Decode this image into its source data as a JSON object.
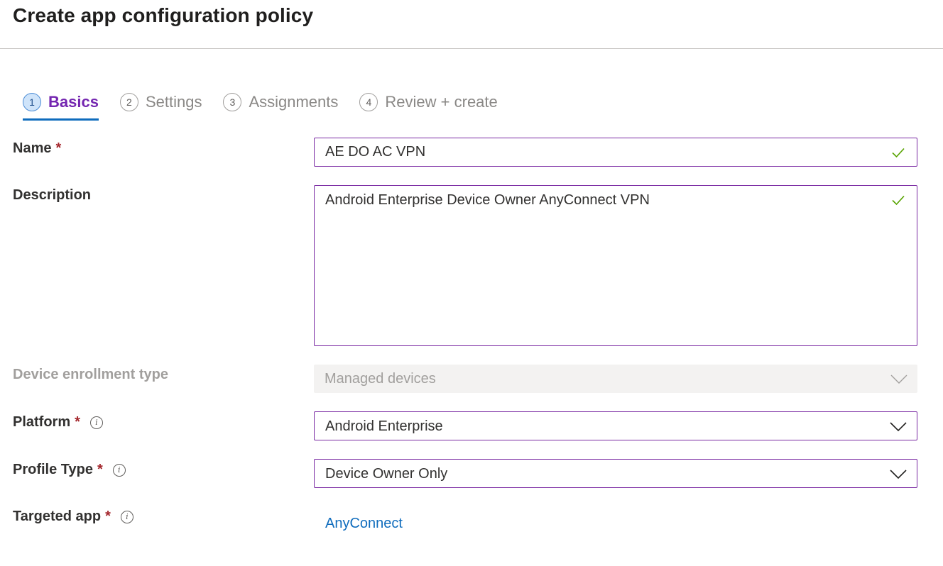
{
  "title": "Create app configuration policy",
  "steps": [
    {
      "number": "1",
      "label": "Basics",
      "active": true
    },
    {
      "number": "2",
      "label": "Settings"
    },
    {
      "number": "3",
      "label": "Assignments"
    },
    {
      "number": "4",
      "label": "Review + create"
    }
  ],
  "fields": {
    "name": {
      "label": "Name",
      "required": "*",
      "value": "AE DO AC VPN",
      "valid": true
    },
    "description": {
      "label": "Description",
      "value": "Android Enterprise Device Owner AnyConnect VPN",
      "valid": true
    },
    "enrollment": {
      "label": "Device enrollment type",
      "value": "Managed devices",
      "disabled": true
    },
    "platform": {
      "label": "Platform",
      "required": "*",
      "value": "Android Enterprise",
      "info_icon": "info-icon"
    },
    "profile_type": {
      "label": "Profile Type",
      "required": "*",
      "value": "Device Owner Only",
      "info_icon": "info-icon"
    },
    "targeted_app": {
      "label": "Targeted app",
      "required": "*",
      "value": "AnyConnect",
      "info_icon": "info-icon"
    }
  },
  "colors": {
    "accent_purple": "#7a2aa3",
    "active_underline": "#0f6cbd",
    "required_star": "#a4262c",
    "valid_check": "#57a300",
    "link": "#0f6cbd"
  }
}
